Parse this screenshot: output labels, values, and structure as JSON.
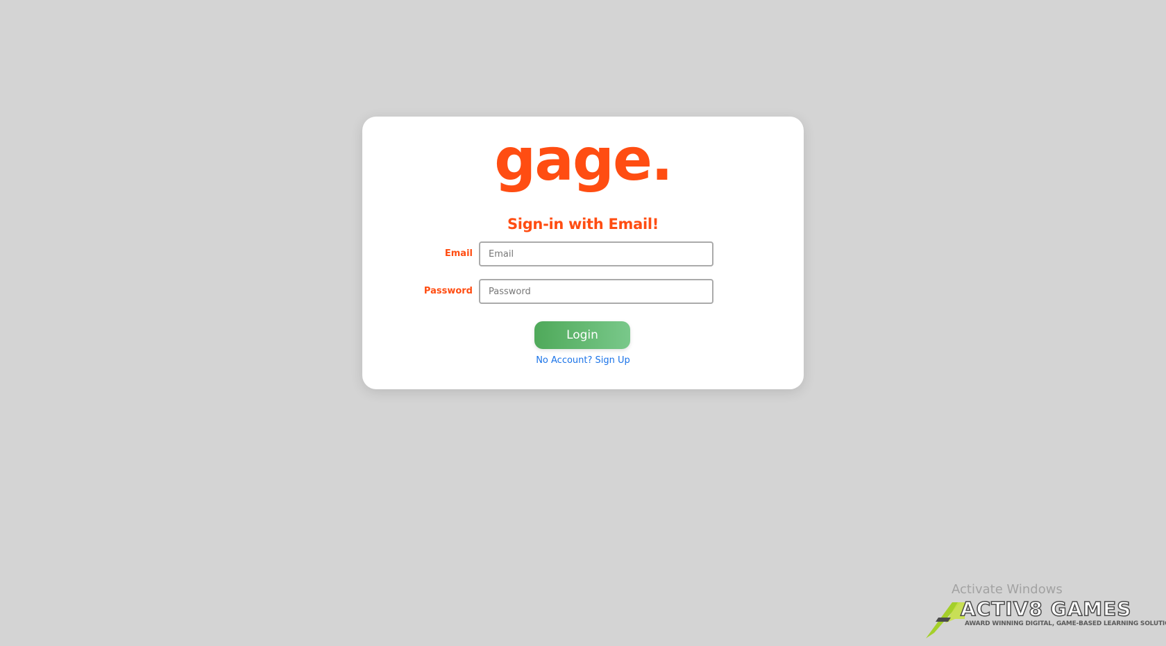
{
  "brand": {
    "logo_text": "gage.",
    "accent_color": "#ff4d12"
  },
  "form": {
    "heading": "Sign-in with Email!",
    "email_label": "Email",
    "email_placeholder": "Email",
    "email_value": "",
    "password_label": "Password",
    "password_placeholder": "Password",
    "password_value": "",
    "login_label": "Login",
    "signup_link": "No Account? Sign Up",
    "login_color": "#5cb46a",
    "link_color": "#1a73e8"
  },
  "watermark": {
    "activate_text": "Activate Windows",
    "company_name": "ACTIV8 GAMES",
    "company_tagline": "AWARD WINNING DIGITAL, GAME-BASED LEARNING SOLUTIONS"
  }
}
